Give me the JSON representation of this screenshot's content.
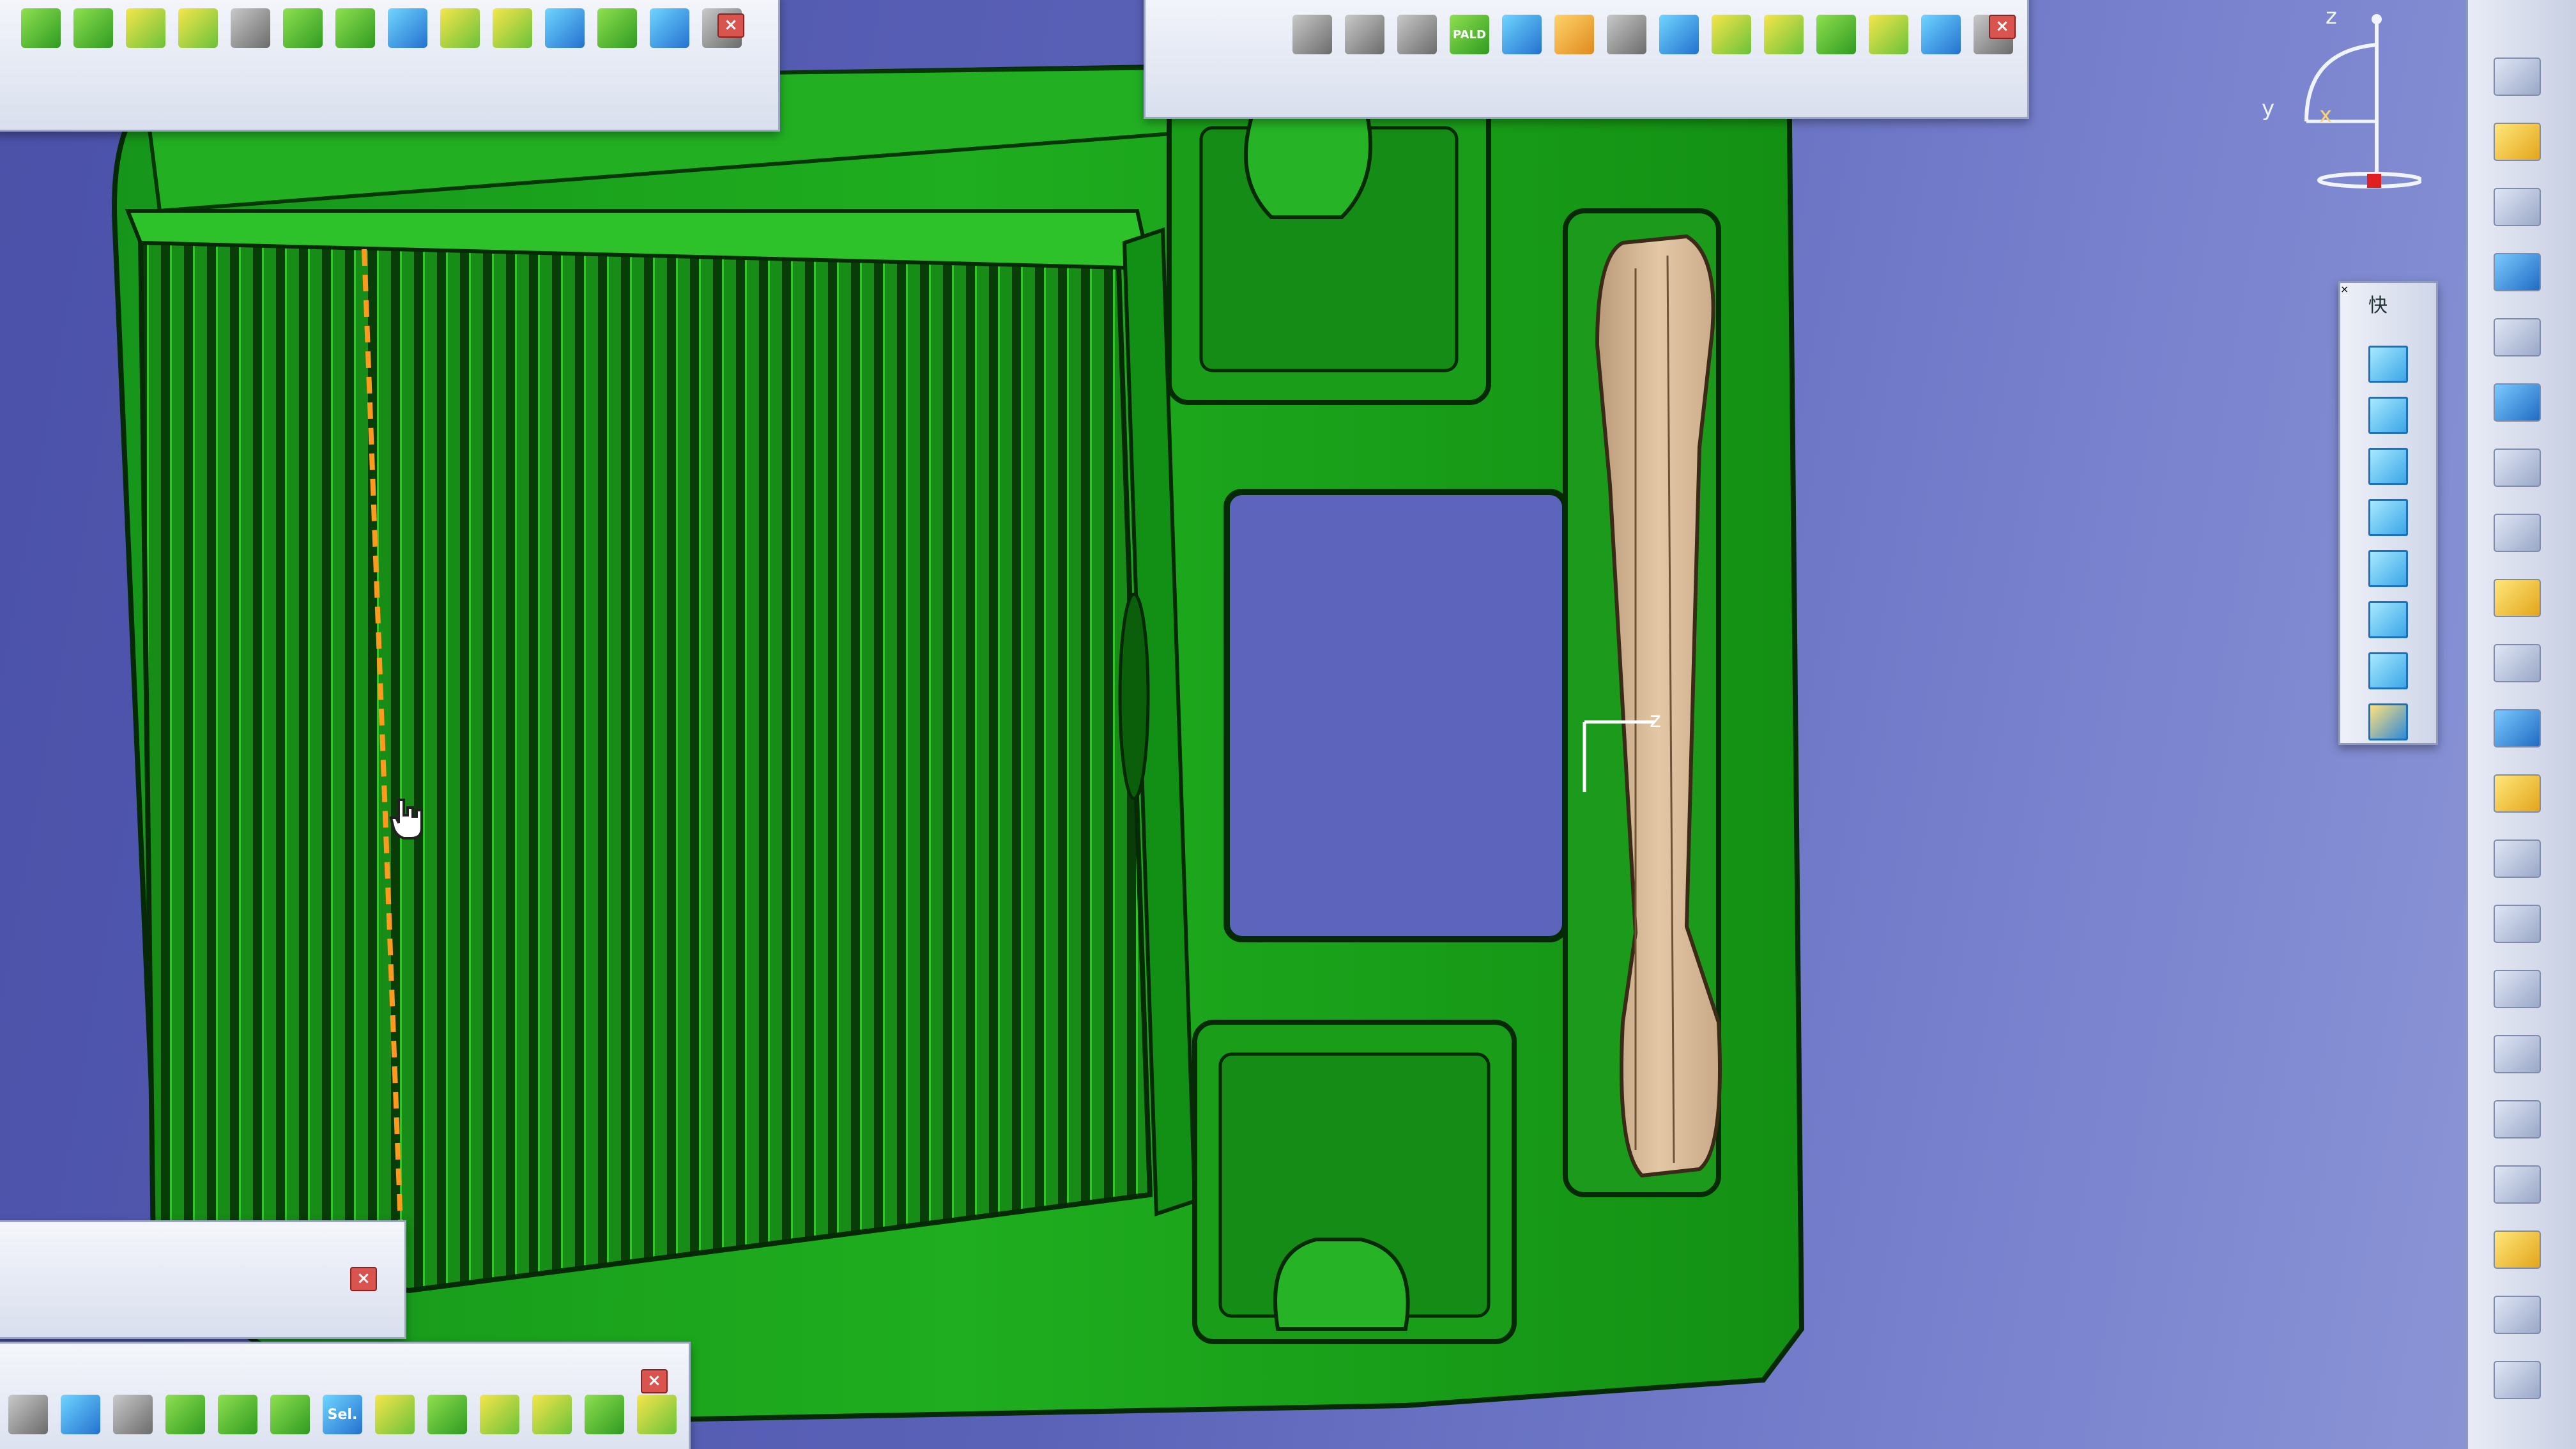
{
  "toolbars": {
    "top_left": {
      "close_label": "×"
    },
    "top_center": {
      "close_label": "×",
      "texts": [
        "PALD"
      ]
    },
    "bottom_left_small": {
      "close_label": "×"
    },
    "bottom_left": {
      "close_label": "×",
      "texts": [
        "Sel."
      ]
    },
    "right_vertical": {
      "title": "快",
      "close_label": "×"
    }
  },
  "compass": {
    "z_label": "z",
    "y_label": "y",
    "x_label": "x"
  },
  "model_axis": {
    "z_label": "z"
  },
  "colors": {
    "part_green": "#1ea21a",
    "part_dark_green": "#0f6f10",
    "handle_beige": "#d9b998",
    "selection_orange": "#ff9a1f",
    "background_blue": "#5a62b8"
  }
}
